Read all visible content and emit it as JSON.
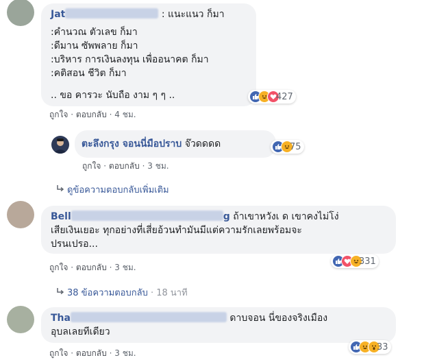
{
  "comments": [
    {
      "name": "Jat",
      "lines": [
        ": แนะแนว ก็มา",
        ":คำนวณ ตัวเลข ก็มา",
        ":ดีมาน ซัพพลาย ก็มา",
        ":บริหาร การเงินลงทุน เพื่ออนาคต ก็มา",
        ":คติสอน ชีวิต ก็มา",
        ".. ขอ คารวะ นับถือ งาม ๆ ๆ .."
      ],
      "reaction_count": "427",
      "like_label": "ถูกใจ",
      "reply_label": "ตอบกลับ",
      "time": "4 ชม."
    },
    {
      "name": "ตะลึงกรุง จอนนี่มือปราบ",
      "text": "จ๊วดดดด",
      "reaction_count": "75",
      "like_label": "ถูกใจ",
      "reply_label": "ตอบกลับ",
      "time": "3 ชม."
    },
    {
      "name": "Bell",
      "name_tail": "g",
      "lines": [
        "ถ้าเขาหวังเ  ด เขาคงไม่โง่",
        "เสียเงินเยอะ ทุกอย่างที่เสี่ยอ้วนทำมันมีแต่ความรักเลยพร้อมจะ",
        "ปรนเปรอ..."
      ],
      "reaction_count": "331",
      "like_label": "ถูกใจ",
      "reply_label": "ตอบกลับ",
      "time": "3 ชม."
    },
    {
      "name": "Tha",
      "lines": [
        "ดาบจอน นี่ของจริงเมือง",
        "อุบลเลยทีเดียว"
      ],
      "reaction_count": "33",
      "like_label": "ถูกใจ",
      "reply_label": "ตอบกลับ",
      "time": "3 ชม."
    }
  ],
  "more_replies": {
    "label": "ดูข้อความตอบกลับเพิ่มเติม"
  },
  "replies_summary": {
    "label": "38 ข้อความตอบกลับ",
    "time": "18 นาที"
  },
  "separator": "·",
  "colors": {
    "like": "#4267b2",
    "love": "#f25268",
    "haha": "#f7b125",
    "link": "#385898"
  }
}
